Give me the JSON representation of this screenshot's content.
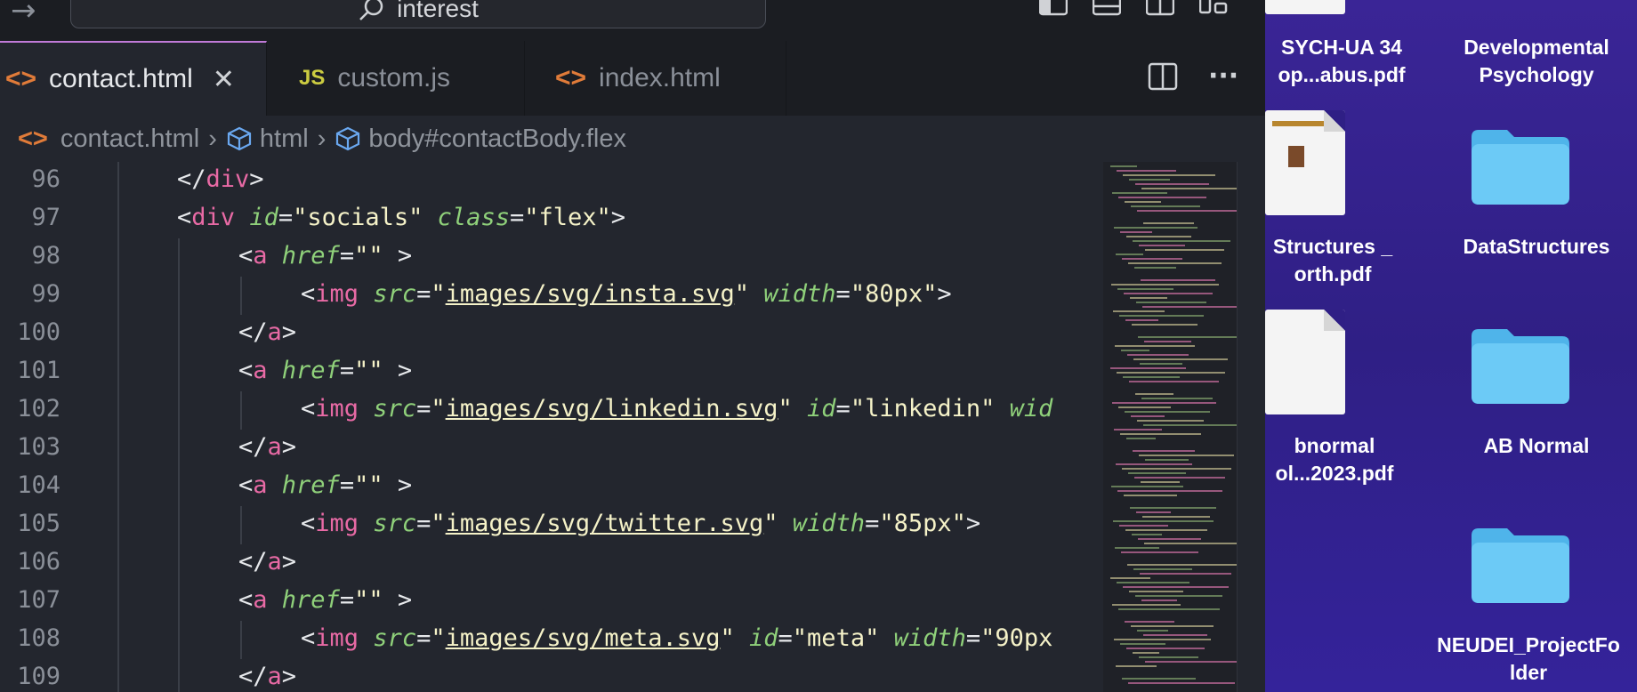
{
  "titlebar": {
    "search_text": "interest",
    "nav_icon": "arrow-right-icon",
    "layout_icons": [
      "sidebar-left-icon",
      "panel-bottom-icon",
      "split-editor-icon",
      "customize-layout-icon"
    ]
  },
  "tabs": [
    {
      "icon_text": "<>",
      "label": "contact.html",
      "close": "✕",
      "active": true,
      "icon_color": "#e07b39"
    },
    {
      "icon_text": "JS",
      "label": "custom.js",
      "active": false,
      "icon_color": "#cbcb41"
    },
    {
      "icon_text": "<>",
      "label": "index.html",
      "active": false,
      "icon_color": "#e07b39"
    }
  ],
  "tab_actions": {
    "more": "···"
  },
  "breadcrumb": {
    "file": "contact.html",
    "element1": "html",
    "element2": "body#contactBody.flex"
  },
  "code": {
    "line_numbers": [
      "96",
      "97",
      "98",
      "99",
      "100",
      "101",
      "102",
      "103",
      "104",
      "105",
      "106",
      "107",
      "108",
      "109"
    ],
    "lines": {
      "l96": {
        "open": "</",
        "tag": "div",
        "close": ">"
      },
      "l97": {
        "open": "<",
        "tag": "div",
        "attr1": "id",
        "eq1": "=",
        "val1": "\"socials\"",
        "attr2": "class",
        "eq2": "=",
        "val2": "\"flex\"",
        "close": ">"
      },
      "l98": {
        "open": "<",
        "tag": "a",
        "attr1": "href",
        "eq1": "=",
        "val1": "\"\"",
        "close": " >"
      },
      "l99": {
        "open": "<",
        "tag": "img",
        "attr1": "src",
        "eq1": "=",
        "q": "\"",
        "val1": "images/svg/insta.svg",
        "attr2": "width",
        "eq2": "=",
        "val2": "\"80px\"",
        "close": ">"
      },
      "l100": {
        "open": "</",
        "tag": "a",
        "close": ">"
      },
      "l101": {
        "open": "<",
        "tag": "a",
        "attr1": "href",
        "eq1": "=",
        "val1": "\"\"",
        "close": " >"
      },
      "l102": {
        "open": "<",
        "tag": "img",
        "attr1": "src",
        "eq1": "=",
        "q": "\"",
        "val1": "images/svg/linkedin.svg",
        "attr2": "id",
        "eq2": "=",
        "val2": "\"linkedin\"",
        "attr3": "wid"
      },
      "l103": {
        "open": "</",
        "tag": "a",
        "close": ">"
      },
      "l104": {
        "open": "<",
        "tag": "a",
        "attr1": "href",
        "eq1": "=",
        "val1": "\"\"",
        "close": " >"
      },
      "l105": {
        "open": "<",
        "tag": "img",
        "attr1": "src",
        "eq1": "=",
        "q": "\"",
        "val1": "images/svg/twitter.svg",
        "attr2": "width",
        "eq2": "=",
        "val2": "\"85px\"",
        "close": ">"
      },
      "l106": {
        "open": "</",
        "tag": "a",
        "close": ">"
      },
      "l107": {
        "open": "<",
        "tag": "a",
        "attr1": "href",
        "eq1": "=",
        "val1": "\"\"",
        "close": " >"
      },
      "l108": {
        "open": "<",
        "tag": "img",
        "attr1": "src",
        "eq1": "=",
        "q": "\"",
        "val1": "images/svg/meta.svg",
        "attr2": "id",
        "eq2": "=",
        "val2": "\"meta\"",
        "attr3": "width",
        "eq3": "=",
        "val3": "\"90px"
      },
      "l109": {
        "open": "</",
        "tag": "a",
        "close": ">"
      }
    }
  },
  "desktop": {
    "items": [
      {
        "name": "psych-pdf",
        "label1": "SYCH-UA 34",
        "label2": "op...abus.pdf"
      },
      {
        "name": "developmental-psychology",
        "label1": "Developmental",
        "label2": "Psychology"
      },
      {
        "name": "data-structures-pdf",
        "label1": "Structures _",
        "label2": "orth.pdf"
      },
      {
        "name": "datastructures-folder",
        "label1": "DataStructures"
      },
      {
        "name": "abnormal-pdf",
        "label1": "bnormal",
        "label2": "ol...2023.pdf"
      },
      {
        "name": "ab-normal-folder",
        "label1": "AB Normal"
      },
      {
        "name": "neudei-folder",
        "label1": "NEUDEI_ProjectFo",
        "label2": "lder"
      }
    ]
  },
  "colors": {
    "tag": "#e86aa5",
    "attr": "#8fd07a",
    "string": "#f5f2c8",
    "folder": "#5cc3f2",
    "desktop_bg": "#2f1f85"
  }
}
